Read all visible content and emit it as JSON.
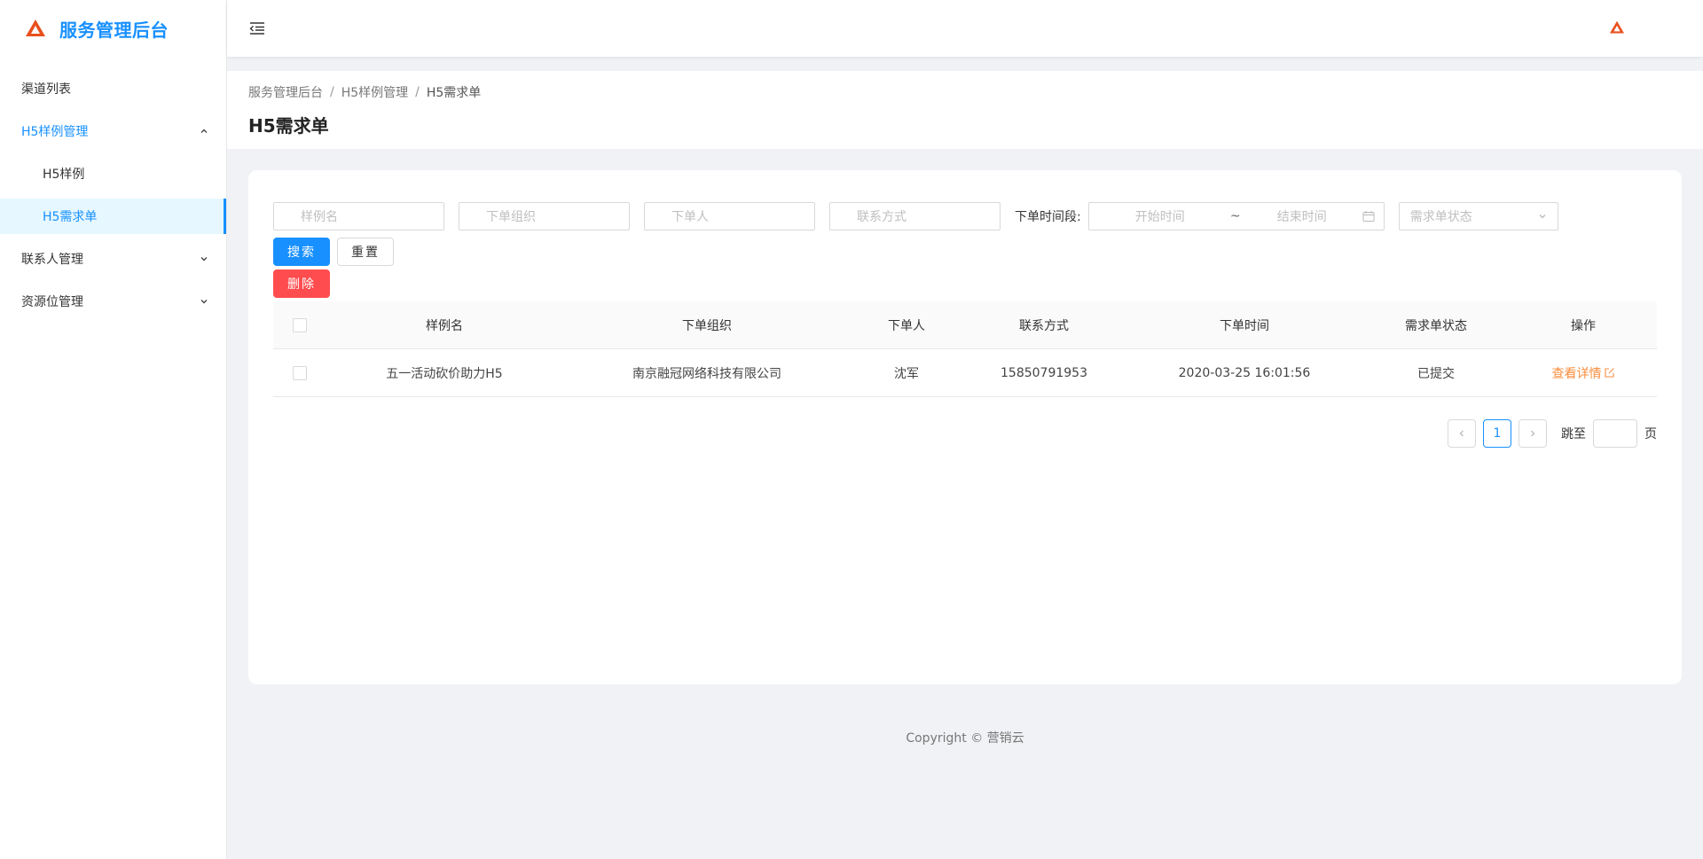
{
  "app": {
    "title": "服务管理后台"
  },
  "sidebar": {
    "items": [
      {
        "label": "渠道列表"
      },
      {
        "label": "H5样例管理"
      },
      {
        "label": "H5样例"
      },
      {
        "label": "H5需求单"
      },
      {
        "label": "联系人管理"
      },
      {
        "label": "资源位管理"
      }
    ]
  },
  "breadcrumb": [
    "服务管理后台",
    "H5样例管理",
    "H5需求单"
  ],
  "breadcrumb_sep": "/",
  "page_title": "H5需求单",
  "filters": {
    "sample_name_placeholder": "样例名",
    "org_placeholder": "下单组织",
    "orderer_placeholder": "下单人",
    "contact_placeholder": "联系方式",
    "range_label": "下单时间段:",
    "start_placeholder": "开始时间",
    "range_sep": "~",
    "end_placeholder": "结束时间",
    "status_placeholder": "需求单状态"
  },
  "buttons": {
    "search": "搜索",
    "reset": "重置",
    "delete": "删除"
  },
  "table": {
    "columns": [
      "样例名",
      "下单组织",
      "下单人",
      "联系方式",
      "下单时间",
      "需求单状态",
      "操作"
    ],
    "rows": [
      {
        "sample_name": "五一活动砍价助力H5",
        "org": "南京融冠网络科技有限公司",
        "orderer": "沈军",
        "contact": "15850791953",
        "time": "2020-03-25 16:01:56",
        "status": "已提交",
        "action": "查看详情"
      }
    ]
  },
  "pagination": {
    "current": "1",
    "jump_label": "跳至",
    "page_suffix": "页"
  },
  "footer": "Copyright © 营销云",
  "colors": {
    "primary": "#1890ff",
    "danger": "#ff4d4f",
    "link": "#fa8c3c",
    "logo": "#e8501e"
  }
}
